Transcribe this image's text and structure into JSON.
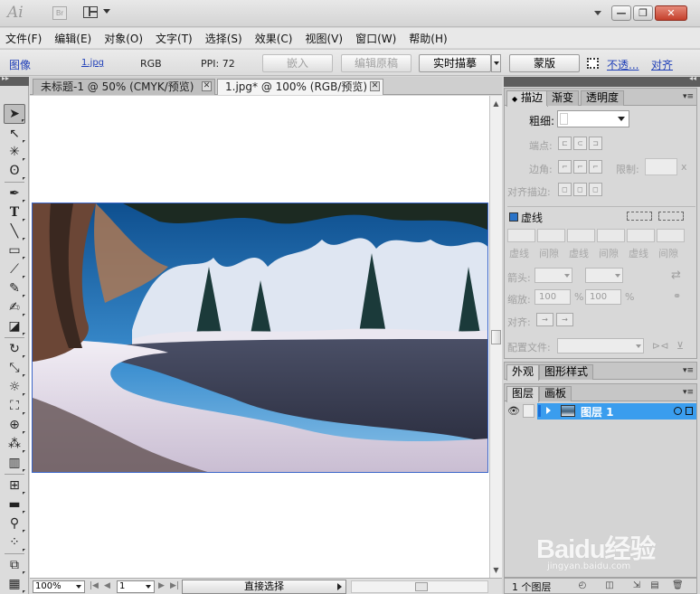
{
  "app": {
    "logo": "Ai",
    "bridge_logo": "Br"
  },
  "menu": [
    "文件(F)",
    "编辑(E)",
    "对象(O)",
    "文字(T)",
    "选择(S)",
    "效果(C)",
    "视图(V)",
    "窗口(W)",
    "帮助(H)"
  ],
  "control_bar": {
    "object_type": "图像",
    "filename": "1.jpg",
    "color_mode": "RGB",
    "ppi": "PPI: 72",
    "embed_btn": "嵌入",
    "edit_original_btn": "编辑原稿",
    "live_trace_btn": "实时描摹",
    "mask_btn": "蒙版",
    "opacity_link": "不透...",
    "align_link": "对齐"
  },
  "doc_tabs": [
    {
      "label": "未标题-1 @ 50% (CMYK/预览)",
      "active": false
    },
    {
      "label": "1.jpg* @ 100% (RGB/预览)",
      "active": true
    }
  ],
  "status_bar": {
    "zoom": "100%",
    "page": "1",
    "status": "直接选择"
  },
  "stroke_panel": {
    "tabs": [
      "描边",
      "渐变",
      "透明度"
    ],
    "weight_label": "粗细:",
    "cap_label": "端点:",
    "corner_label": "边角:",
    "limit_label": "限制:",
    "limit_x": "x",
    "align_label": "对齐描边:",
    "dashed_label": "虚线",
    "dash_labels": [
      "虚线",
      "间隙",
      "虚线",
      "间隙",
      "虚线",
      "间隙"
    ],
    "arrow_label": "箭头:",
    "scale_label": "缩放:",
    "scale_values": [
      "100",
      "100"
    ],
    "percent": "%",
    "align_arrow_label": "对齐:",
    "profile_label": "配置文件:"
  },
  "appearance_panel": {
    "tabs": [
      "外观",
      "图形样式"
    ]
  },
  "layers_panel": {
    "tabs": [
      "图层",
      "画板"
    ],
    "layers": [
      {
        "name": "图层 1",
        "selected": true,
        "color": "#1a6fd8"
      }
    ],
    "count": "1 个图层"
  },
  "watermark": {
    "main": "Baidu经验",
    "sub": "jingyan.baidu.com"
  }
}
